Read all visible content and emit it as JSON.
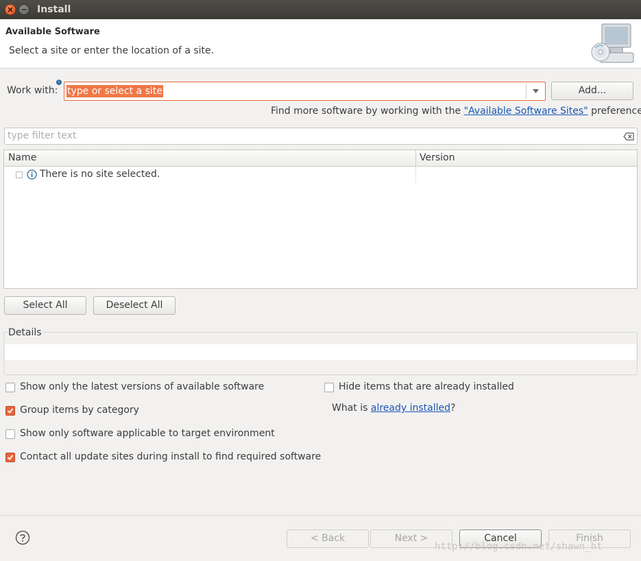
{
  "window": {
    "title": "Install"
  },
  "header": {
    "title": "Available Software",
    "description": "Select a site or enter the location of a site."
  },
  "work_with": {
    "label": "Work with:",
    "value": "type or select a site",
    "add_label": "Add..."
  },
  "find_more": {
    "prefix": "Find more software by working with the ",
    "link": "\"Available Software Sites\"",
    "suffix": " preferences."
  },
  "filter": {
    "placeholder": "type filter text"
  },
  "table": {
    "columns": [
      "Name",
      "Version"
    ],
    "rows": [
      {
        "name": "There is no site selected.",
        "checked": false
      }
    ]
  },
  "buttons": {
    "select_all": "Select All",
    "deselect_all": "Deselect All"
  },
  "details": {
    "label": "Details"
  },
  "options": [
    {
      "label": "Show only the latest versions of available software",
      "checked": false
    },
    {
      "label": "Hide items that are already installed",
      "checked": false
    },
    {
      "label": "Group items by category",
      "checked": true
    },
    {
      "label": "Show only software applicable to target environment",
      "checked": false
    },
    {
      "label": "Contact all update sites during install to find required software",
      "checked": true
    }
  ],
  "installed_hint": {
    "prefix": "What is ",
    "link": "already installed",
    "suffix": "?"
  },
  "footer": {
    "back": "< Back",
    "next": "Next >",
    "cancel": "Cancel",
    "finish": "Finish"
  },
  "watermark": "http://blog.csdn.net/shawn_ht",
  "colors": {
    "accent": "#e8643b",
    "link": "#1b57b3",
    "selection": "#f07746"
  },
  "icons": [
    "close-icon",
    "minimize-icon",
    "software-install-icon",
    "info-icon",
    "dropdown-arrow-icon",
    "clear-filter-icon",
    "help-icon",
    "checkmark-icon"
  ]
}
